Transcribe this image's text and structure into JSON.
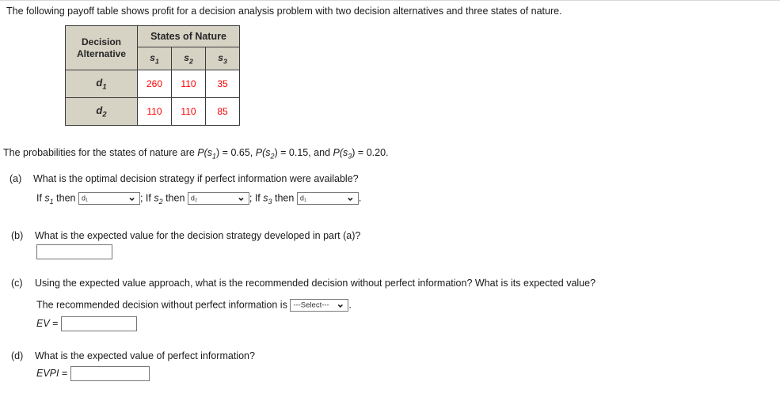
{
  "intro": "The following payoff table shows profit for a decision analysis problem with two decision alternatives and three states of nature.",
  "table": {
    "decision_alternative_line1": "Decision",
    "decision_alternative_line2": "Alternative",
    "states_of_nature_header": "States of Nature",
    "state_labels": [
      "s",
      "s",
      "s"
    ],
    "state_subscripts": [
      "1",
      "2",
      "3"
    ],
    "rows": [
      {
        "alt_label": "d",
        "alt_subscript": "1",
        "values": [
          "260",
          "110",
          "35"
        ]
      },
      {
        "alt_label": "d",
        "alt_subscript": "2",
        "values": [
          "110",
          "110",
          "85"
        ]
      }
    ],
    "header_bg": "#d6d2c4",
    "value_color": "#ff0000"
  },
  "probabilities": {
    "prefix": "The probabilities for the states of nature are ",
    "p1_label": "P(s",
    "p1_sub": "1",
    "p1_value": ") = 0.65, ",
    "p2_label": "P(s",
    "p2_sub": "2",
    "p2_value": ") = 0.15, and ",
    "p3_label": "P(s",
    "p3_sub": "3",
    "p3_value": ") = 0.20."
  },
  "part_a": {
    "marker": "(a)",
    "question": "What is the optimal decision strategy if perfect information were available?",
    "if1_prefix": "If ",
    "s1": "s",
    "s1_sub": "1",
    "then1": " then ",
    "select1_value": "d₁",
    "sep1": "; If ",
    "s2": "s",
    "s2_sub": "2",
    "then2": " then ",
    "select2_value": "d₂",
    "sep2": "; If ",
    "s3": "s",
    "s3_sub": "3",
    "then3": " then ",
    "select3_value": "d₁",
    "period": "."
  },
  "part_b": {
    "marker": "(b)",
    "question": "What is the expected value for the decision strategy developed in part (a)?",
    "input_value": "",
    "input_placeholder": ""
  },
  "part_c": {
    "marker": "(c)",
    "question": "Using the expected value approach, what is the recommended decision without perfect information? What is its expected value?",
    "sentence": "The recommended decision without perfect information is",
    "select_value": "---Select---",
    "period": ".",
    "ev_label": "EV",
    "ev_equals": " = ",
    "ev_value": "",
    "ev_placeholder": ""
  },
  "part_d": {
    "marker": "(d)",
    "question": "What is the expected value of perfect information?",
    "evpi_label": "EVPI",
    "evpi_equals": " = ",
    "evpi_value": "",
    "evpi_placeholder": ""
  }
}
